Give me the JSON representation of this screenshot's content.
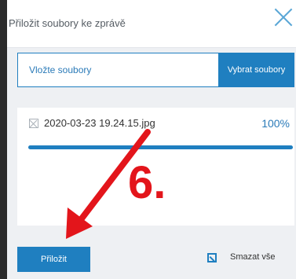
{
  "dialog": {
    "title": "Přiložit soubory ke zprávě",
    "close_icon": "close-icon"
  },
  "upload": {
    "placeholder": "Vložte soubory",
    "choose_label": "Vybrat soubory"
  },
  "files": [
    {
      "name": "2020-03-23 19.24.15.jpg",
      "progress_text": "100%",
      "progress": 1.0
    }
  ],
  "footer": {
    "attach_label": "Přiložit",
    "clear_all_label": "Smazat vše",
    "clear_icon": "clear-icon"
  },
  "annotation": {
    "step_label": "6.",
    "color": "#e3151b"
  },
  "colors": {
    "accent": "#1f7fc0",
    "backdrop": "#2b2b2b",
    "panel": "#eef0f3"
  }
}
